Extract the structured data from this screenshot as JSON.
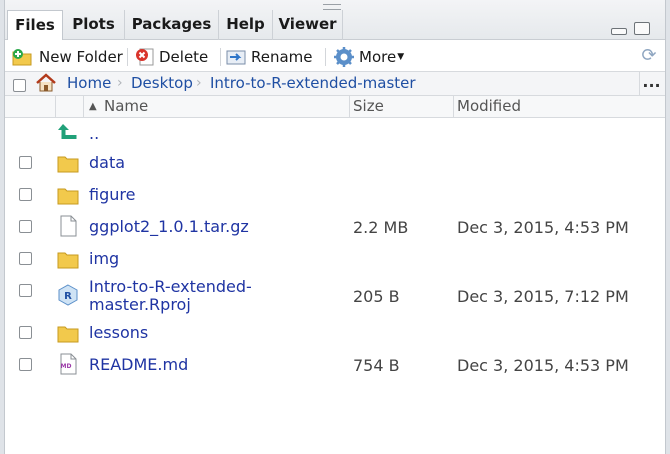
{
  "tabs": [
    "Files",
    "Plots",
    "Packages",
    "Help",
    "Viewer"
  ],
  "toolbar": {
    "new_folder": "New Folder",
    "delete": "Delete",
    "rename": "Rename",
    "more": "More"
  },
  "breadcrumb": [
    "Home",
    "Desktop",
    "Intro-to-R-extended-master"
  ],
  "breadcrumb_more": "...",
  "columns": {
    "name": "Name",
    "size": "Size",
    "modified": "Modified"
  },
  "parent_dir": "..",
  "files": [
    {
      "name": "data",
      "type": "folder",
      "size": "",
      "modified": ""
    },
    {
      "name": "figure",
      "type": "folder",
      "size": "",
      "modified": ""
    },
    {
      "name": "ggplot2_1.0.1.tar.gz",
      "type": "file",
      "size": "2.2 MB",
      "modified": "Dec 3, 2015, 4:53 PM"
    },
    {
      "name": "img",
      "type": "folder",
      "size": "",
      "modified": ""
    },
    {
      "name_line1": "Intro-to-R-extended-",
      "name_line2": "master.Rproj",
      "type": "rproj",
      "size": "205 B",
      "modified": "Dec 3, 2015, 7:12 PM"
    },
    {
      "name": "lessons",
      "type": "folder",
      "size": "",
      "modified": ""
    },
    {
      "name": "README.md",
      "type": "markdown",
      "size": "754 B",
      "modified": "Dec 3, 2015, 4:53 PM"
    }
  ],
  "icons": {
    "md_badge": "MD"
  },
  "colors": {
    "link": "#1f34a3",
    "folder": "#f2c94c",
    "up_arrow": "#21a179"
  }
}
